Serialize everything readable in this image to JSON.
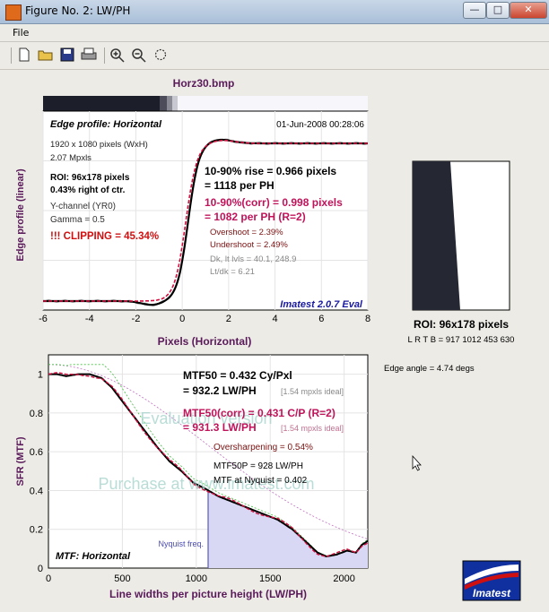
{
  "window": {
    "title": "Figure No. 2: LW/PH"
  },
  "menu": {
    "file": "File"
  },
  "toolbar": {
    "new": "new-icon",
    "open": "open-icon",
    "save": "save-icon",
    "print": "print-icon",
    "zoom_in": "zoom-in-icon",
    "zoom_out": "zoom-out-icon",
    "rotate": "rotate-icon"
  },
  "figure": {
    "file_title": "Horz30.bmp",
    "edge": {
      "title": "Edge profile: Horizontal",
      "date": "01-Jun-2008 00:28:06",
      "ylabel": "Edge profile (linear)",
      "xlabel": "Pixels (Horizontal)",
      "xticks": [
        "-6",
        "-4",
        "-2",
        "0",
        "2",
        "4",
        "6",
        "8"
      ],
      "info": [
        "1920 x 1080 pixels (WxH)",
        "2.07 Mpxls"
      ],
      "roi_lines": [
        "ROI: 96x178 pixels",
        "0.43% right of ctr."
      ],
      "channel": [
        "Y-channel  (YR0)",
        "Gamma = 0.5"
      ],
      "clipping": "!!! CLIPPING =  45.34%",
      "rise1": "10-90% rise = 0.966 pixels",
      "rise2": "= 1118 per PH",
      "corr1": "10-90%(corr) = 0.998 pixels",
      "corr2": "= 1082 per PH  (R=2)",
      "overshoot": "Overshoot = 2.39%",
      "undershoot": "Undershoot = 2.49%",
      "levels": "Dk, lt lvls = 40.1, 248.9",
      "ratio": "Lt/dk = 6.21",
      "brand": "Imatest 2.0.7 Eval"
    },
    "mtf": {
      "title": "MTF: Horizontal",
      "ylabel": "SFR (MTF)",
      "xlabel": "Line widths per picture height (LW/PH)",
      "yticks": [
        "0",
        "0.2",
        "0.4",
        "0.6",
        "0.8",
        "1"
      ],
      "xticks": [
        "0",
        "500",
        "1000",
        "1500",
        "2000"
      ],
      "mtf50_1": "MTF50 = 0.432 Cy/Pxl",
      "mtf50_2": "= 932.2 LW/PH",
      "ideal": "[1.54 mpxls ideal]",
      "corr1": "MTF50(corr) = 0.431 C/P  (R=2)",
      "corr2": "= 931.3 LW/PH",
      "ideal2": "[1.54 mpxls ideal]",
      "oversharp": "Oversharpening = 0.54%",
      "mtf50p": "MTF50P = 928 LW/PH",
      "nyquist_val": "MTF at Nyquist = 0.402",
      "nyquist": "Nyquist freq.",
      "watermark1": "Evaluation version",
      "watermark2": "Purchase at www.imatest.com"
    },
    "roi": {
      "label": "ROI: 96x178 pixels",
      "lrtb": "L R  T B = 917 1012  453 630",
      "angle": "Edge angle = 4.74 degs"
    },
    "logo": "Imatest"
  },
  "colors": {
    "accent": "#5a1a5a",
    "brand": "#1a1aa0",
    "magenta": "#c0135a",
    "clip": "#d01010"
  }
}
